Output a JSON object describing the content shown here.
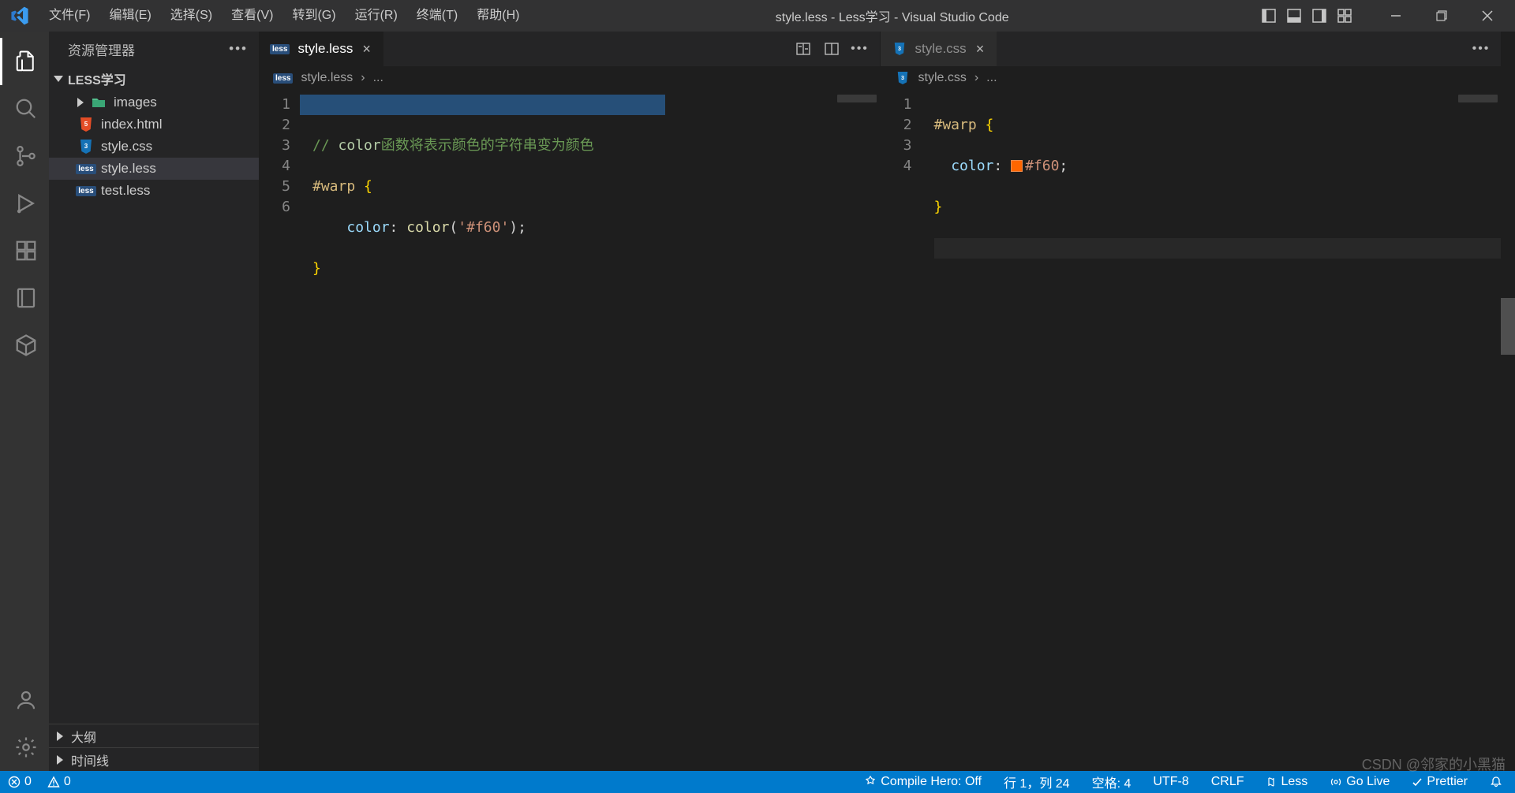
{
  "title_bar": {
    "title": "style.less - Less学习 - Visual Studio Code",
    "menu": [
      "文件(F)",
      "编辑(E)",
      "选择(S)",
      "查看(V)",
      "转到(G)",
      "运行(R)",
      "终端(T)",
      "帮助(H)"
    ]
  },
  "sidebar": {
    "header": "资源管理器",
    "project": "LESS学习",
    "tree": [
      {
        "name": "images",
        "type": "folder"
      },
      {
        "name": "index.html",
        "type": "html"
      },
      {
        "name": "style.css",
        "type": "css"
      },
      {
        "name": "style.less",
        "type": "less",
        "active": true
      },
      {
        "name": "test.less",
        "type": "less"
      }
    ],
    "outline": "大纲",
    "timeline": "时间线"
  },
  "editor_left": {
    "tab_label": "style.less",
    "breadcrumbs": {
      "file": "style.less",
      "tail": "..."
    },
    "lines": [
      "1",
      "2",
      "3",
      "4",
      "5",
      "6"
    ],
    "code": {
      "comment_prefix": "// ",
      "comment_keyword": "color",
      "comment_rest": "函数将表示颜色的字符串变为颜色",
      "selector": "#warp",
      "open_brace": "{",
      "prop": "color",
      "colon": ": ",
      "fn": "color",
      "paren_open": "(",
      "str": "'#f60'",
      "paren_close": ")",
      "semi": ";",
      "close_brace": "}"
    }
  },
  "editor_right": {
    "tab_label": "style.css",
    "breadcrumbs": {
      "file": "style.css",
      "tail": "..."
    },
    "lines": [
      "1",
      "2",
      "3",
      "4"
    ],
    "code": {
      "selector": "#warp",
      "open_brace": "{",
      "prop": "color",
      "colon": ": ",
      "value": "#f60",
      "semi": ";",
      "close_brace": "}",
      "swatch_color": "#ff6600"
    }
  },
  "status": {
    "errors": "0",
    "warnings": "0",
    "compile_hero": "Compile Hero: Off",
    "ln_col": "行 1，列 24",
    "spaces": "空格: 4",
    "encoding": "UTF-8",
    "eol": "CRLF",
    "language": "Less",
    "go_live": "Go Live",
    "prettier": "Prettier"
  },
  "watermark": "CSDN @邻家的小黑猫"
}
